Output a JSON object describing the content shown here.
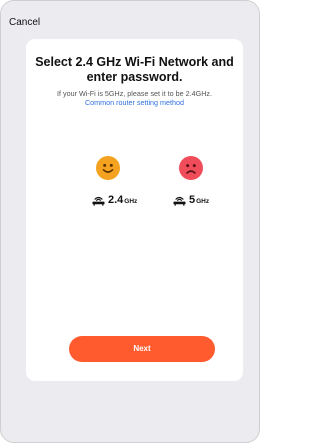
{
  "header": {
    "cancel_label": "Cancel"
  },
  "content": {
    "title": "Select 2.4 GHz Wi-Fi Network and enter password.",
    "subtitle": "If your Wi-Fi is 5GHz, please set it to be 2.4GHz.",
    "link_text": "Common router setting method"
  },
  "bands": [
    {
      "face": "happy-face-icon",
      "number": "2.4",
      "unit": "GHz",
      "face_color": "#f4a21f"
    },
    {
      "face": "sad-face-icon",
      "number": "5",
      "unit": "GHz",
      "face_color": "#f04c5a"
    }
  ],
  "footer": {
    "next_label": "Next",
    "next_color": "#ff5b2e"
  },
  "colors": {
    "background": "#ececf0",
    "card": "#ffffff",
    "link": "#2f6fe0"
  }
}
